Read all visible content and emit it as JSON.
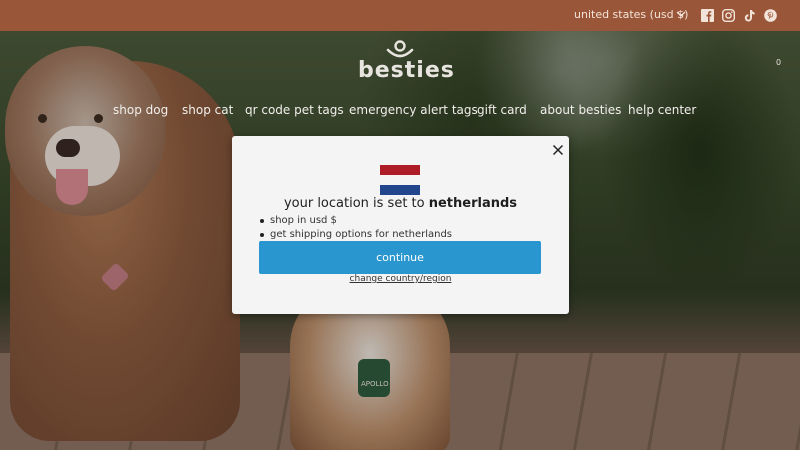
{
  "topbar": {
    "currency_label": "united states (usd $)",
    "social": [
      "facebook-icon",
      "instagram-icon",
      "tiktok-icon",
      "pinterest-icon"
    ]
  },
  "brand": {
    "logo_text": "besties",
    "cart_count": "0"
  },
  "nav": {
    "items": [
      {
        "label": "shop dog"
      },
      {
        "label": "shop cat"
      },
      {
        "label": "qr code pet tags"
      },
      {
        "label": "emergency alert tags"
      },
      {
        "label": "gift card"
      },
      {
        "label": "about besties"
      },
      {
        "label": "help center"
      }
    ]
  },
  "hero": {
    "tag_text": "APOLLO"
  },
  "modal": {
    "headline_prefix": "your location is set to ",
    "headline_country": "netherlands",
    "bullets": [
      "shop in usd $",
      "get shipping options for netherlands"
    ],
    "continue_label": "continue",
    "change_label": "change country/region",
    "flag_colors": [
      "#ae1c28",
      "#f4f4f4",
      "#21468b"
    ]
  },
  "colors": {
    "topbar": "#9a5638",
    "accent": "#2a96cf",
    "modal_bg": "#f4f4f4"
  }
}
